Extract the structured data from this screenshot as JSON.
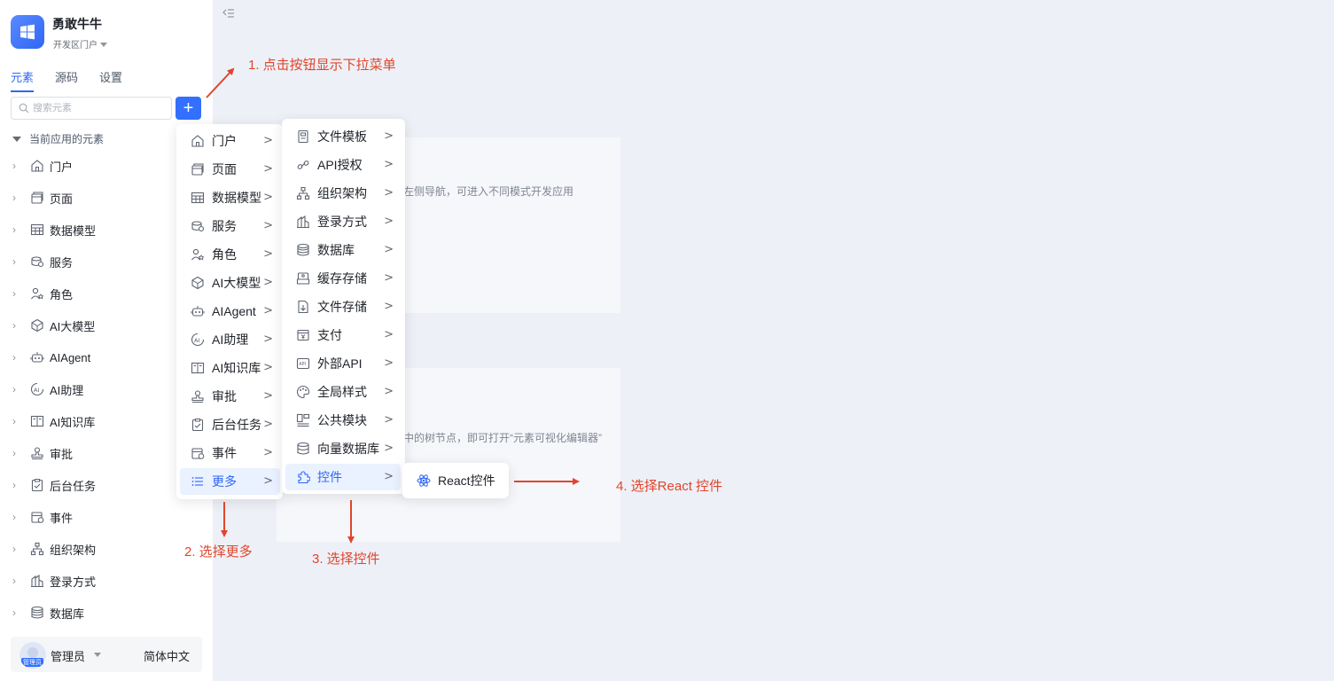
{
  "app": {
    "name": "勇敢牛牛",
    "env": "开发区门户"
  },
  "tabs": [
    {
      "label": "元素",
      "active": true
    },
    {
      "label": "源码",
      "active": false
    },
    {
      "label": "设置",
      "active": false
    }
  ],
  "search": {
    "placeholder": "搜索元素"
  },
  "add_button": {
    "label": "+"
  },
  "tree": {
    "section_label": "当前应用的元素",
    "items": [
      {
        "label": "门户",
        "icon": "home-icon"
      },
      {
        "label": "页面",
        "icon": "page-icon"
      },
      {
        "label": "数据模型",
        "icon": "table-icon"
      },
      {
        "label": "服务",
        "icon": "service-icon"
      },
      {
        "label": "角色",
        "icon": "role-icon"
      },
      {
        "label": "AI大模型",
        "icon": "ai-model-icon"
      },
      {
        "label": "AIAgent",
        "icon": "robot-icon"
      },
      {
        "label": "AI助理",
        "icon": "ai-assistant-icon"
      },
      {
        "label": "AI知识库",
        "icon": "book-icon"
      },
      {
        "label": "审批",
        "icon": "stamp-icon"
      },
      {
        "label": "后台任务",
        "icon": "task-icon"
      },
      {
        "label": "事件",
        "icon": "event-icon"
      },
      {
        "label": "组织架构",
        "icon": "org-icon"
      },
      {
        "label": "登录方式",
        "icon": "login-icon"
      },
      {
        "label": "数据库",
        "icon": "database-icon"
      }
    ]
  },
  "user": {
    "name": "管理员",
    "avatar_tag": "管理员",
    "language": "简体中文"
  },
  "menu1": {
    "items": [
      {
        "label": "门户",
        "icon": "home-icon"
      },
      {
        "label": "页面",
        "icon": "page-icon"
      },
      {
        "label": "数据模型",
        "icon": "table-icon"
      },
      {
        "label": "服务",
        "icon": "service-icon"
      },
      {
        "label": "角色",
        "icon": "role-icon"
      },
      {
        "label": "AI大模型",
        "icon": "ai-model-icon"
      },
      {
        "label": "AIAgent",
        "icon": "robot-icon"
      },
      {
        "label": "AI助理",
        "icon": "ai-assistant-icon"
      },
      {
        "label": "AI知识库",
        "icon": "book-icon"
      },
      {
        "label": "审批",
        "icon": "stamp-icon"
      },
      {
        "label": "后台任务",
        "icon": "task-icon"
      },
      {
        "label": "事件",
        "icon": "event-icon"
      },
      {
        "label": "更多",
        "icon": "list-icon",
        "active": true
      }
    ]
  },
  "menu2": {
    "items": [
      {
        "label": "文件模板",
        "icon": "file-template-icon"
      },
      {
        "label": "API授权",
        "icon": "link-icon"
      },
      {
        "label": "组织架构",
        "icon": "org-icon"
      },
      {
        "label": "登录方式",
        "icon": "login-icon"
      },
      {
        "label": "数据库",
        "icon": "database-icon"
      },
      {
        "label": "缓存存储",
        "icon": "cache-icon"
      },
      {
        "label": "文件存储",
        "icon": "file-storage-icon"
      },
      {
        "label": "支付",
        "icon": "pay-icon"
      },
      {
        "label": "外部API",
        "icon": "api-icon"
      },
      {
        "label": "全局样式",
        "icon": "palette-icon"
      },
      {
        "label": "公共模块",
        "icon": "module-icon"
      },
      {
        "label": "向量数据库",
        "icon": "vector-db-icon"
      },
      {
        "label": "控件",
        "icon": "puzzle-icon",
        "active": true
      }
    ]
  },
  "menu3": {
    "items": [
      {
        "label": "React控件",
        "icon": "react-icon"
      }
    ]
  },
  "background": {
    "hint1": "左侧导航，可进入不同模式开发应用",
    "hint2": "中的树节点，即可打开“元素可视化编辑器”"
  },
  "annotations": {
    "step1": "1. 点击按钮显示下拉菜单",
    "step2": "2. 选择更多",
    "step3": "3. 选择控件",
    "step4": "4. 选择React 控件"
  },
  "colors": {
    "primary": "#3370ff",
    "annotation": "#e0452b",
    "active_bg": "#eaf1ff"
  }
}
